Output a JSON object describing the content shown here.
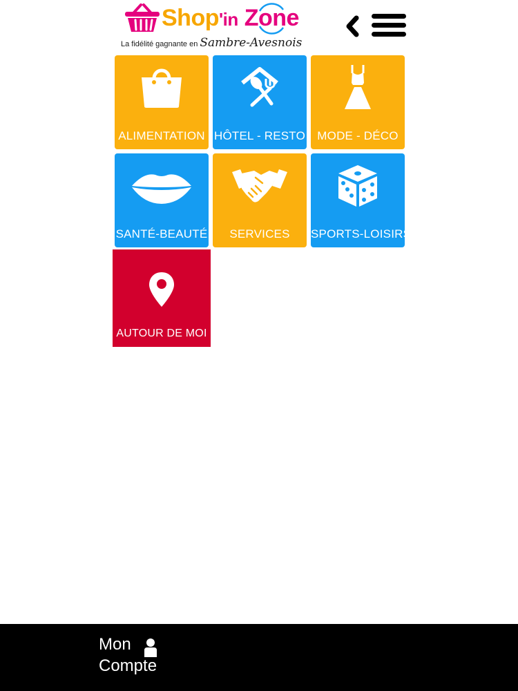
{
  "header": {
    "logo": {
      "title_shop": "Shop",
      "title_in": "'in",
      "title_zone": "Zone",
      "tagline_prefix": "La fidélité gagnante en",
      "tagline_region": "Sambre-Avesnois"
    },
    "back_icon": "chevron-left-icon",
    "menu_icon": "hamburger-menu-icon"
  },
  "colors": {
    "orange": "#fbb00e",
    "blue": "#159cf2",
    "red": "#d2002d",
    "footer": "#000000"
  },
  "tiles": [
    {
      "label": "ALIMENTATION",
      "icon": "shopping-bag-icon",
      "color": "orange"
    },
    {
      "label": "HÔTEL - RESTO",
      "icon": "house-fork-spoon-icon",
      "color": "blue"
    },
    {
      "label": "MODE - DÉCO",
      "icon": "dress-icon",
      "color": "orange"
    },
    {
      "label": "SANTÉ-BEAUTÉ",
      "icon": "lips-icon",
      "color": "blue"
    },
    {
      "label": "SERVICES",
      "icon": "handshake-icon",
      "color": "orange"
    },
    {
      "label": "SPORTS-LOISIRS",
      "icon": "dice-icon",
      "color": "blue"
    },
    {
      "label": "AUTOUR DE MOI",
      "icon": "map-pin-icon",
      "color": "red"
    }
  ],
  "footer": {
    "account_line1": "Mon",
    "account_line2": "Compte",
    "account_icon": "user-icon"
  }
}
